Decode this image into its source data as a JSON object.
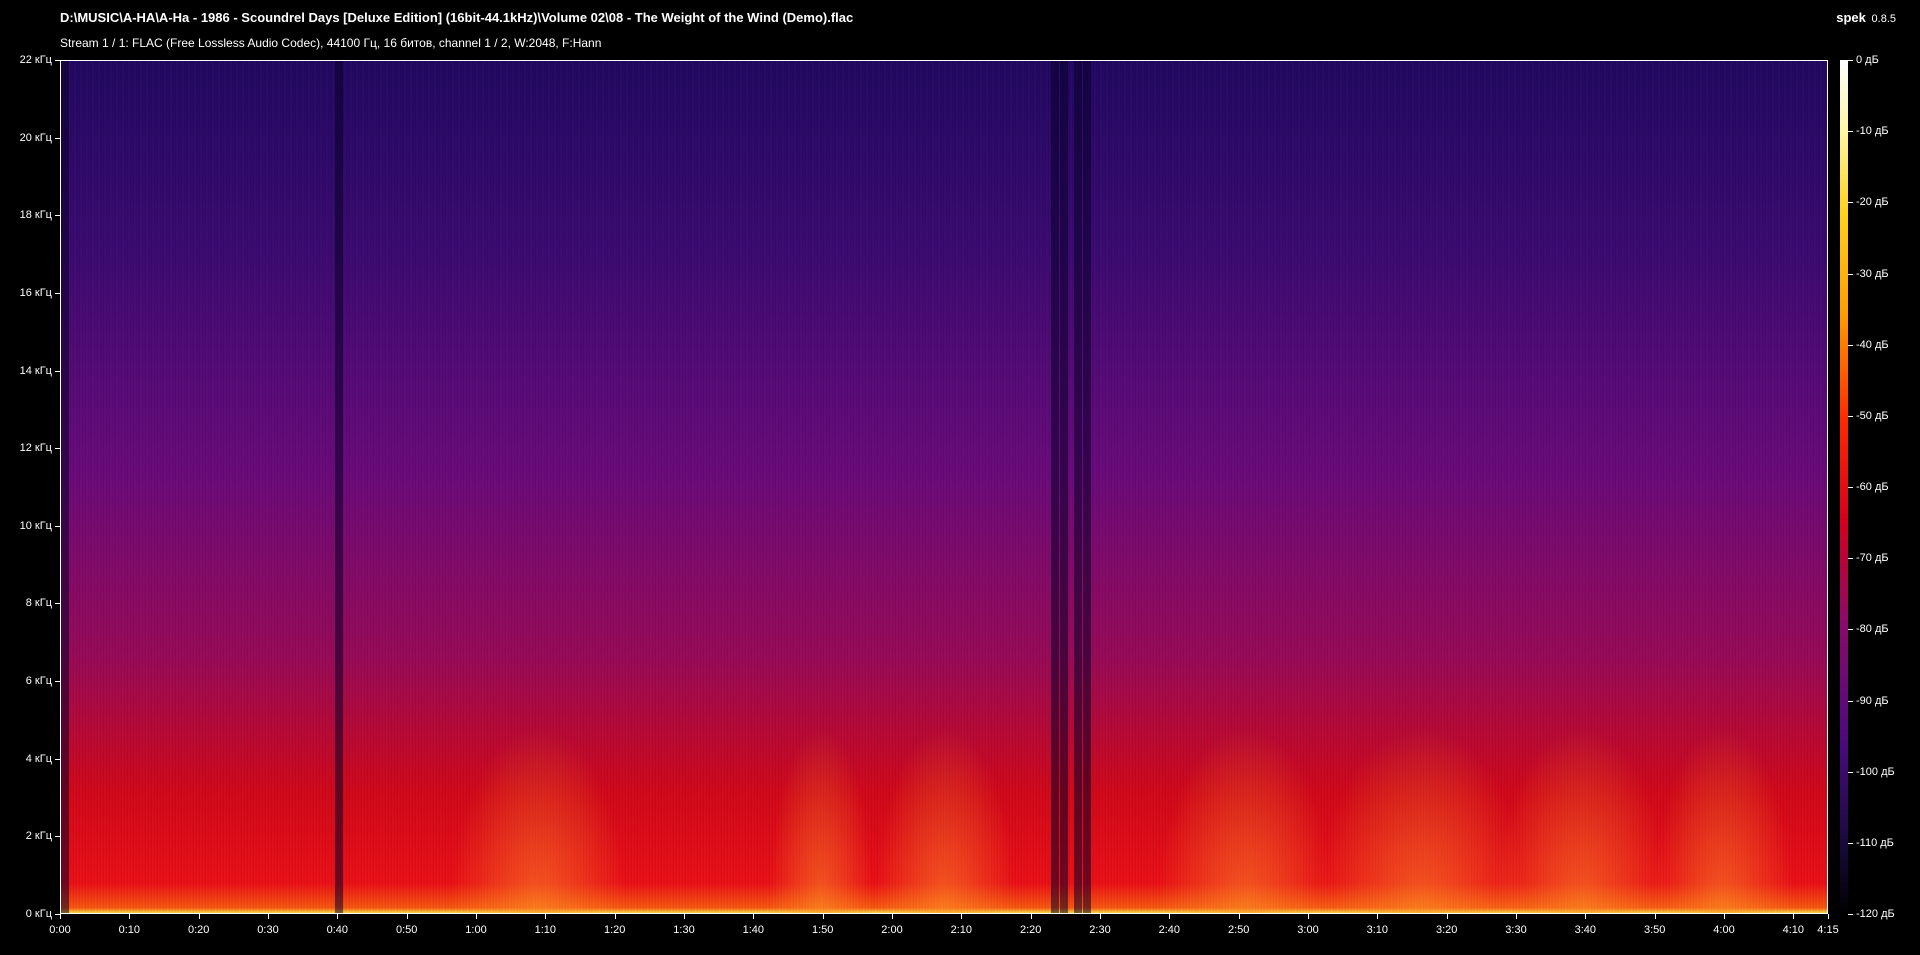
{
  "header": {
    "title": "D:\\MUSIC\\A-HA\\A-Ha - 1986 - Scoundrel Days [Deluxe Edition] (16bit-44.1kHz)\\Volume 02\\08 - The Weight of the Wind (Demo).flac",
    "subtitle": "Stream 1 / 1: FLAC (Free Lossless Audio Codec), 44100 Гц, 16 битов, channel 1 / 2, W:2048, F:Hann",
    "app_name": "spek",
    "app_version": "0.8.5"
  },
  "colors": {
    "background": "#000000",
    "text": "#ffffff",
    "palette": [
      "#000000",
      "#4a0a7e",
      "#d4001c",
      "#ff9a00",
      "#ffd21a",
      "#ffffff"
    ]
  },
  "chart_data": {
    "type": "heatmap",
    "title": "",
    "xlabel": "",
    "ylabel": "",
    "x_unit": "time (m:ss)",
    "xlim": [
      0,
      255
    ],
    "y_unit": "kHz",
    "ylim": [
      0,
      22
    ],
    "x_ticks": [
      {
        "t": 0,
        "label": "0:00"
      },
      {
        "t": 10,
        "label": "0:10"
      },
      {
        "t": 20,
        "label": "0:20"
      },
      {
        "t": 30,
        "label": "0:30"
      },
      {
        "t": 40,
        "label": "0:40"
      },
      {
        "t": 50,
        "label": "0:50"
      },
      {
        "t": 60,
        "label": "1:00"
      },
      {
        "t": 70,
        "label": "1:10"
      },
      {
        "t": 80,
        "label": "1:20"
      },
      {
        "t": 90,
        "label": "1:30"
      },
      {
        "t": 100,
        "label": "1:40"
      },
      {
        "t": 110,
        "label": "1:50"
      },
      {
        "t": 120,
        "label": "2:00"
      },
      {
        "t": 130,
        "label": "2:10"
      },
      {
        "t": 140,
        "label": "2:20"
      },
      {
        "t": 150,
        "label": "2:30"
      },
      {
        "t": 160,
        "label": "2:40"
      },
      {
        "t": 170,
        "label": "2:50"
      },
      {
        "t": 180,
        "label": "3:00"
      },
      {
        "t": 190,
        "label": "3:10"
      },
      {
        "t": 200,
        "label": "3:20"
      },
      {
        "t": 210,
        "label": "3:30"
      },
      {
        "t": 220,
        "label": "3:40"
      },
      {
        "t": 230,
        "label": "3:50"
      },
      {
        "t": 240,
        "label": "4:00"
      },
      {
        "t": 250,
        "label": "4:10"
      },
      {
        "t": 255,
        "label": "4:15"
      }
    ],
    "y_ticks": [
      {
        "v": 0,
        "label": "0 кГц"
      },
      {
        "v": 2,
        "label": "2 кГц"
      },
      {
        "v": 4,
        "label": "4 кГц"
      },
      {
        "v": 6,
        "label": "6 кГц"
      },
      {
        "v": 8,
        "label": "8 кГц"
      },
      {
        "v": 10,
        "label": "10 кГц"
      },
      {
        "v": 12,
        "label": "12 кГц"
      },
      {
        "v": 14,
        "label": "14 кГц"
      },
      {
        "v": 16,
        "label": "16 кГц"
      },
      {
        "v": 18,
        "label": "18 кГц"
      },
      {
        "v": 20,
        "label": "20 кГц"
      },
      {
        "v": 22,
        "label": "22 кГц"
      }
    ],
    "colorbar": {
      "unit": "дБ",
      "range": [
        -120,
        0
      ],
      "ticks": [
        {
          "v": 0,
          "label": "0 дБ"
        },
        {
          "v": -10,
          "label": "-10 дБ"
        },
        {
          "v": -20,
          "label": "-20 дБ"
        },
        {
          "v": -30,
          "label": "-30 дБ"
        },
        {
          "v": -40,
          "label": "-40 дБ"
        },
        {
          "v": -50,
          "label": "-50 дБ"
        },
        {
          "v": -60,
          "label": "-60 дБ"
        },
        {
          "v": -70,
          "label": "-70 дБ"
        },
        {
          "v": -80,
          "label": "-80 дБ"
        },
        {
          "v": -90,
          "label": "-90 дБ"
        },
        {
          "v": -100,
          "label": "-100 дБ"
        },
        {
          "v": -110,
          "label": "-110 дБ"
        },
        {
          "v": -120,
          "label": "-120 дБ"
        }
      ]
    },
    "grid": false,
    "legend": "right colorbar"
  }
}
